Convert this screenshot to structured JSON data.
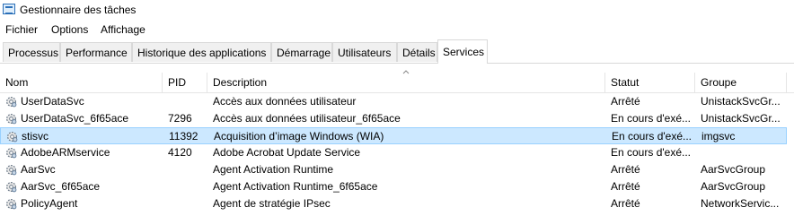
{
  "window": {
    "title": "Gestionnaire des tâches"
  },
  "menu": [
    "Fichier",
    "Options",
    "Affichage"
  ],
  "tabs": [
    {
      "label": "Processus"
    },
    {
      "label": "Performance"
    },
    {
      "label": "Historique des applications"
    },
    {
      "label": "Démarrage"
    },
    {
      "label": "Utilisateurs"
    },
    {
      "label": "Détails"
    },
    {
      "label": "Services",
      "active": true
    }
  ],
  "columns": {
    "name": "Nom",
    "pid": "PID",
    "description": "Description",
    "status": "Statut",
    "group": "Groupe"
  },
  "rows": [
    {
      "name": "UserDataSvc",
      "pid": "",
      "description": "Accès aux données utilisateur",
      "status": "Arrêté",
      "group": "UnistackSvcGr..."
    },
    {
      "name": "UserDataSvc_6f65ace",
      "pid": "7296",
      "description": "Accès aux données utilisateur_6f65ace",
      "status": "En cours d'exé...",
      "group": "UnistackSvcGr..."
    },
    {
      "name": "stisvc",
      "pid": "11392",
      "description": "Acquisition d’image Windows (WIA)",
      "status": "En cours d'exé...",
      "group": "imgsvc",
      "selected": true
    },
    {
      "name": "AdobeARMservice",
      "pid": "4120",
      "description": "Adobe Acrobat Update Service",
      "status": "En cours d'exé...",
      "group": ""
    },
    {
      "name": "AarSvc",
      "pid": "",
      "description": "Agent Activation Runtime",
      "status": "Arrêté",
      "group": "AarSvcGroup"
    },
    {
      "name": "AarSvc_6f65ace",
      "pid": "",
      "description": "Agent Activation Runtime_6f65ace",
      "status": "Arrêté",
      "group": "AarSvcGroup"
    },
    {
      "name": "PolicyAgent",
      "pid": "",
      "description": "Agent de stratégie IPsec",
      "status": "Arrêté",
      "group": "NetworkServic..."
    }
  ],
  "icons": {
    "row": "service-gear-icon",
    "sort": "sort-ascending-icon"
  },
  "colors": {
    "selection": "#cce8ff",
    "selection_border": "#99d1ff"
  }
}
